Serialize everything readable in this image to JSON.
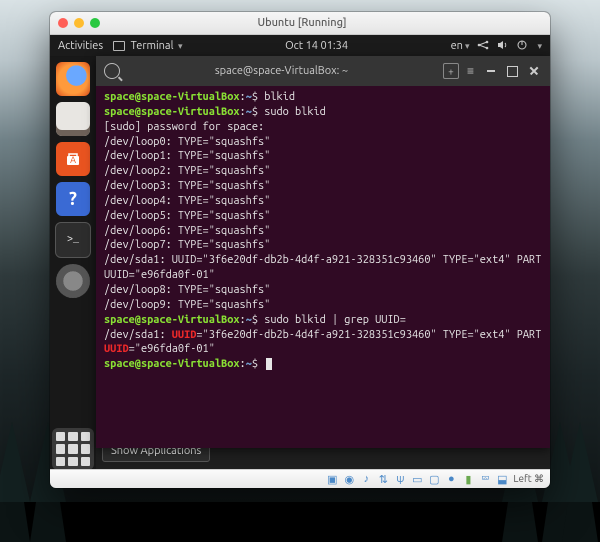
{
  "host": {
    "title": "Ubuntu [Running]",
    "capture_key": "Left ⌘"
  },
  "topbar": {
    "activities": "Activities",
    "app_menu": "Terminal",
    "clock": "Oct 14  01:34",
    "lang": "en"
  },
  "dock": {
    "show_apps_tooltip": "Show Applications"
  },
  "terminal": {
    "title": "space@space-VirtualBox: ~",
    "prompt_user": "space@space-VirtualBox",
    "prompt_sep": ":",
    "prompt_path": "~",
    "prompt_char": "$",
    "cmd1": "blkid",
    "cmd2": "sudo blkid",
    "sudo_prompt": "[sudo] password for space:",
    "loops_a": [
      "/dev/loop0: TYPE=\"squashfs\"",
      "/dev/loop1: TYPE=\"squashfs\"",
      "/dev/loop2: TYPE=\"squashfs\"",
      "/dev/loop3: TYPE=\"squashfs\"",
      "/dev/loop4: TYPE=\"squashfs\"",
      "/dev/loop5: TYPE=\"squashfs\"",
      "/dev/loop6: TYPE=\"squashfs\"",
      "/dev/loop7: TYPE=\"squashfs\""
    ],
    "sda1_line": "/dev/sda1: UUID=\"3f6e20df-db2b-4d4f-a921-328351c93460\" TYPE=\"ext4\" PARTUUID=\"e96fda0f-01\"",
    "loops_b": [
      "/dev/loop8: TYPE=\"squashfs\"",
      "/dev/loop9: TYPE=\"squashfs\""
    ],
    "cmd3": "sudo blkid | grep UUID=",
    "grep_result": {
      "pre": "/dev/sda1: ",
      "uuid_key": "UUID",
      "uuid_rest": "=\"3f6e20df-db2b-4d4f-a921-328351c93460\" TYPE=\"ext4\" PART",
      "part_key": "UUID",
      "part_rest": "=\"e96fda0f-01\""
    }
  }
}
